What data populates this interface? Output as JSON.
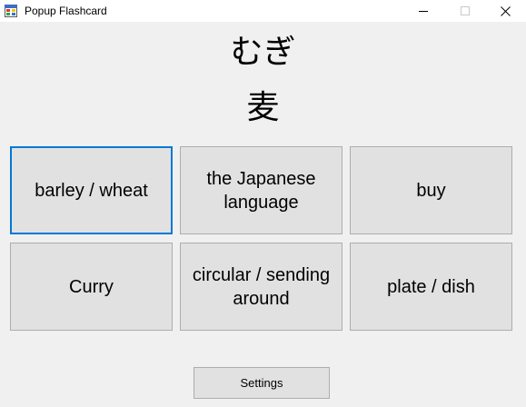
{
  "window": {
    "title": "Popup Flashcard",
    "icon": "app-window-icon",
    "controls": [
      "minimize-icon",
      "maximize-icon",
      "close-icon"
    ]
  },
  "card": {
    "reading": "むぎ",
    "kanji": "麦"
  },
  "answers": [
    {
      "label": "barley / wheat",
      "focused": true
    },
    {
      "label": "the Japanese language",
      "focused": false
    },
    {
      "label": "buy",
      "focused": false
    },
    {
      "label": "Curry",
      "focused": false
    },
    {
      "label": "circular / sending around",
      "focused": false
    },
    {
      "label": "plate / dish",
      "focused": false
    }
  ],
  "settings": {
    "label": "Settings"
  },
  "colors": {
    "background": "#f0f0f0",
    "button_face": "#e1e1e1",
    "button_border": "#adadad",
    "focus_border": "#0078d7"
  }
}
